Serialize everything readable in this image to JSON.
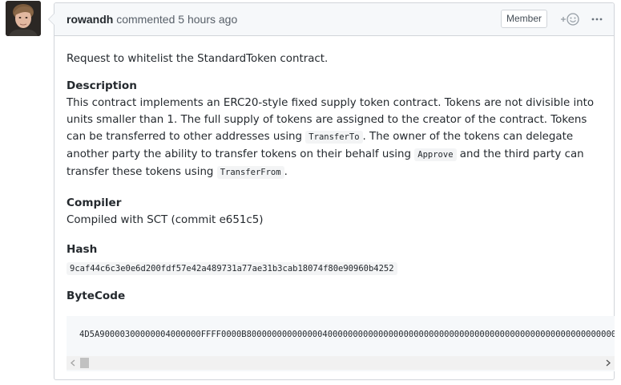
{
  "comment": {
    "author": "rowandh",
    "action": "commented",
    "time": "5 hours ago",
    "badge": "Member",
    "intro": "Request to whitelist the StandardToken contract.",
    "description": {
      "heading": "Description",
      "text_1": "This contract implements an ERC20-style fixed supply token contract. Tokens are not divisible into units smaller than 1. The full supply of tokens are assigned to the creator of the contract. Tokens can be transferred to other addresses using ",
      "code_1": "TransferTo",
      "text_2": ". The owner of the tokens can delegate another party the ability to transfer tokens on their behalf using ",
      "code_2": "Approve",
      "text_3": " and the third party can transfer these tokens using ",
      "code_3": "TransferFrom",
      "text_4": "."
    },
    "compiler": {
      "heading": "Compiler",
      "text": "Compiled with SCT (commit e651c5)"
    },
    "hash": {
      "heading": "Hash",
      "value": "9caf44c6c3e0e6d200fdf57e42a489731a77ae31b3cab18074f80e90960b4252"
    },
    "bytecode": {
      "heading": "ByteCode",
      "value": "4D5A90000300000004000000FFFF0000B8000000000000004000000000000000000000000000000000000000000000000000000000000000"
    }
  },
  "icons": {
    "reaction": "smiley-plus-icon",
    "more": "kebab-horizontal-icon",
    "scroll_left": "chevron-left-icon",
    "scroll_right": "chevron-right-icon"
  },
  "colors": {
    "border": "#d1d5da",
    "header_bg": "#f6f8fa",
    "text": "#24292e",
    "muted": "#586069"
  }
}
